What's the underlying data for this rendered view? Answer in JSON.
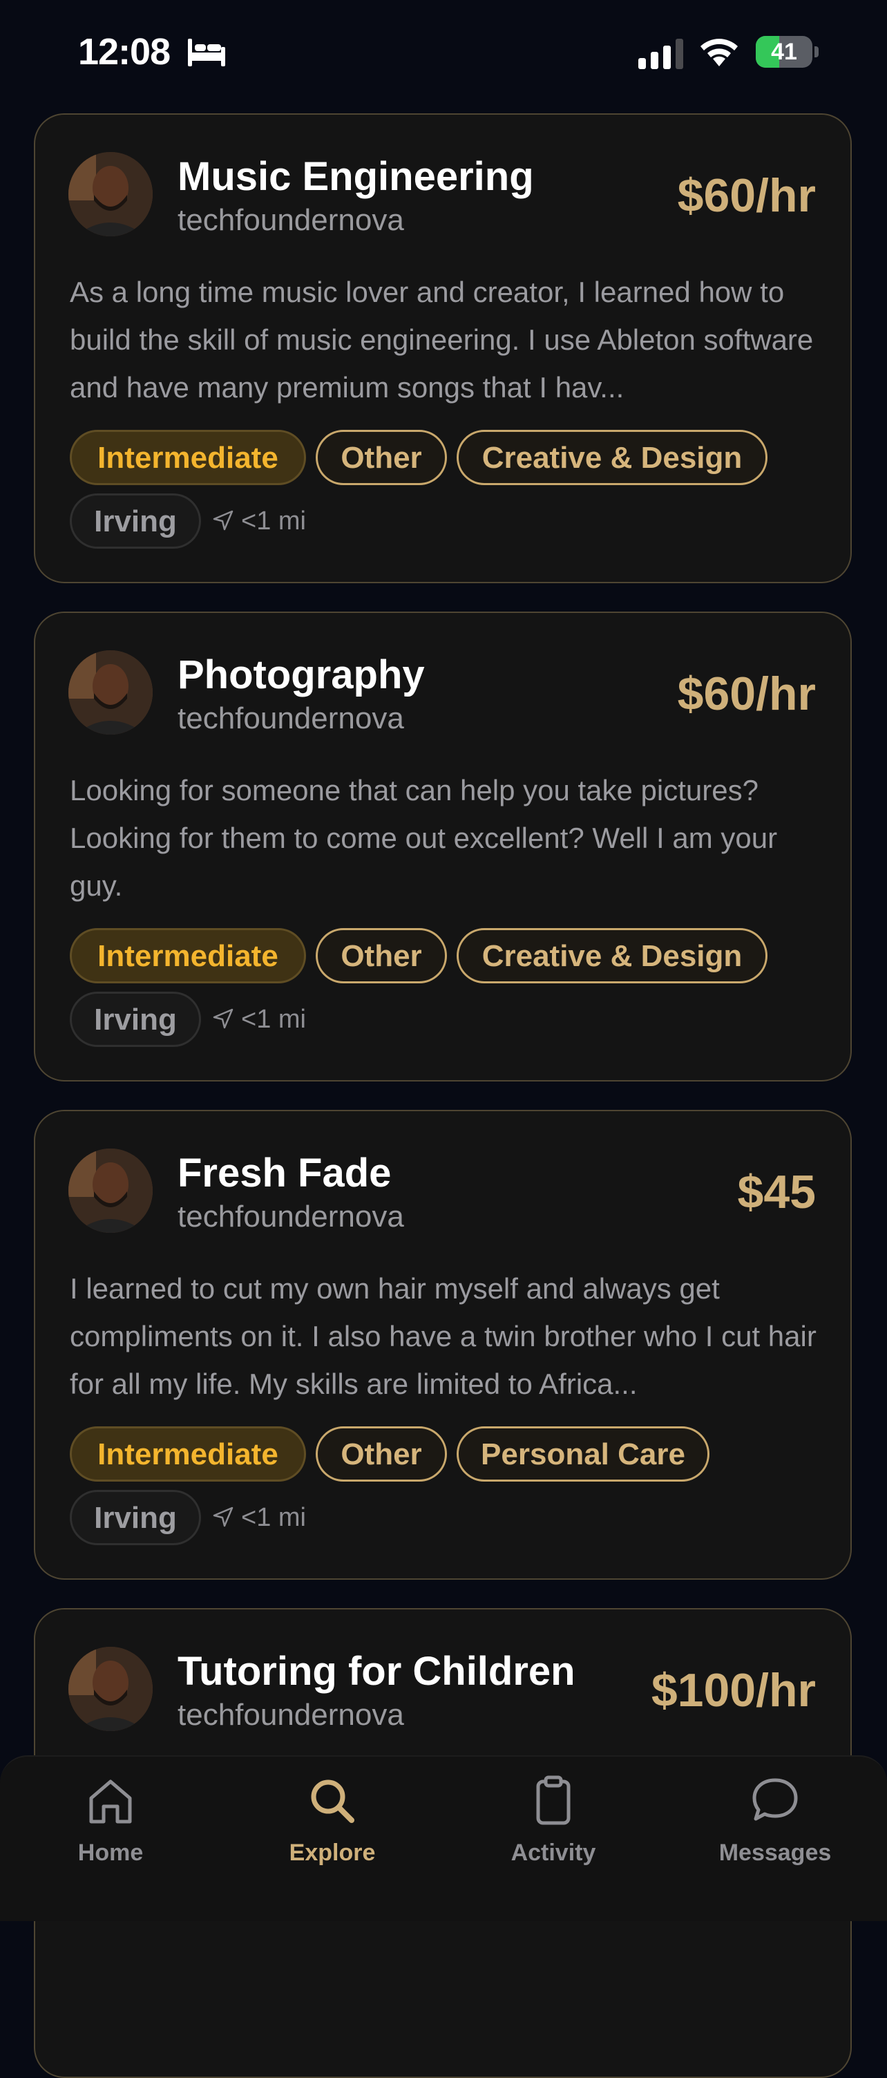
{
  "status_bar": {
    "time": "12:08",
    "battery_level": "41",
    "battery_fraction": 0.41,
    "battery_color": "#34c759"
  },
  "colors": {
    "background": "#070a14",
    "card": "#141414",
    "accent_gold": "#cfb07a",
    "level_yellow": "#f4b52e"
  },
  "listings": [
    {
      "title": "Music Engineering",
      "user": "techfoundernova",
      "price": "$60/hr",
      "description": "As a long time music lover and creator, I learned how to build the skill of music engineering. I use Ableton software and have many premium songs that I hav...",
      "level": "Intermediate",
      "categories": [
        "Other",
        "Creative & Design"
      ],
      "city": "Irving",
      "distance": "<1 mi"
    },
    {
      "title": "Photography",
      "user": "techfoundernova",
      "price": "$60/hr",
      "description": "Looking for someone that can help you take pictures? Looking for them to come out excellent? Well I am your guy.",
      "level": "Intermediate",
      "categories": [
        "Other",
        "Creative & Design"
      ],
      "city": "Irving",
      "distance": "<1 mi"
    },
    {
      "title": "Fresh Fade",
      "user": "techfoundernova",
      "price": "$45",
      "description": "I learned to cut my own hair myself and always get compliments on it. I also have a twin brother who I cut hair for all my life. My skills are limited to Africa...",
      "level": "Intermediate",
      "categories": [
        "Other",
        "Personal Care"
      ],
      "city": "Irving",
      "distance": "<1 mi"
    },
    {
      "title": "Tutoring for Children",
      "user": "techfoundernova",
      "price": "$100/hr"
    }
  ],
  "tab_bar": {
    "items": [
      {
        "label": "Home",
        "icon": "home-icon"
      },
      {
        "label": "Explore",
        "icon": "search-icon",
        "active": true
      },
      {
        "label": "Activity",
        "icon": "clipboard-icon"
      },
      {
        "label": "Messages",
        "icon": "chat-bubble-icon"
      }
    ]
  }
}
